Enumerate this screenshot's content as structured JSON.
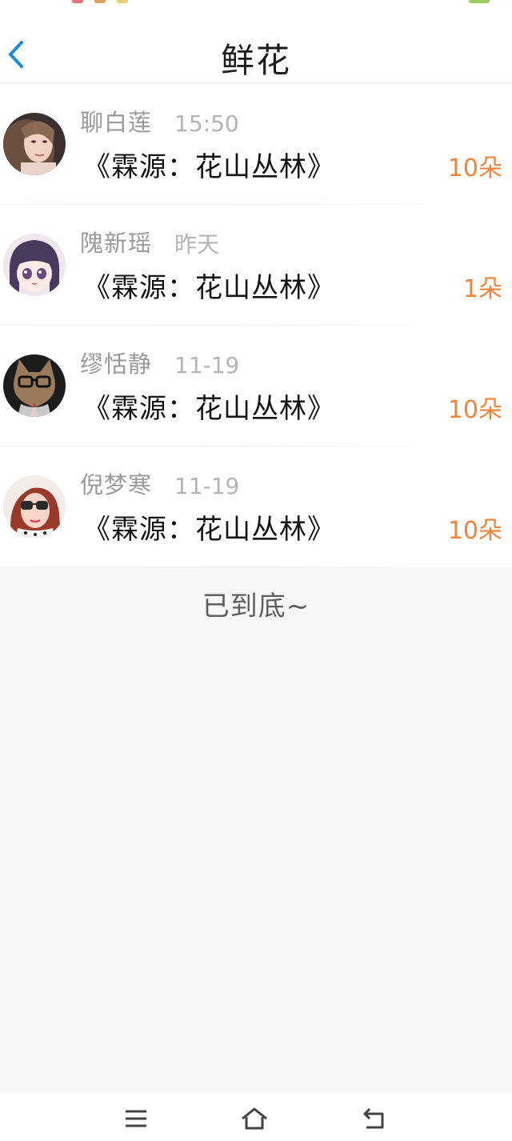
{
  "header": {
    "title": "鲜花"
  },
  "rows": [
    {
      "name": "聊白莲",
      "time": "15:50",
      "book": "《霖源：花山丛林》",
      "count": "10朵"
    },
    {
      "name": "隗新瑶",
      "time": "昨天",
      "book": "《霖源：花山丛林》",
      "count": "1朵"
    },
    {
      "name": "缪恬静",
      "time": "11-19",
      "book": "《霖源：花山丛林》",
      "count": "10朵"
    },
    {
      "name": "倪梦寒",
      "time": "11-19",
      "book": "《霖源：花山丛林》",
      "count": "10朵"
    }
  ],
  "footer": {
    "end_text": "已到底~"
  },
  "colors": {
    "accent": "#1e88e5",
    "count": "#f0843a",
    "background": "#f8f6f7"
  },
  "icons": {
    "back": "chevron-left-icon",
    "menu": "menu-icon",
    "home": "home-icon",
    "back_nav": "return-icon"
  }
}
